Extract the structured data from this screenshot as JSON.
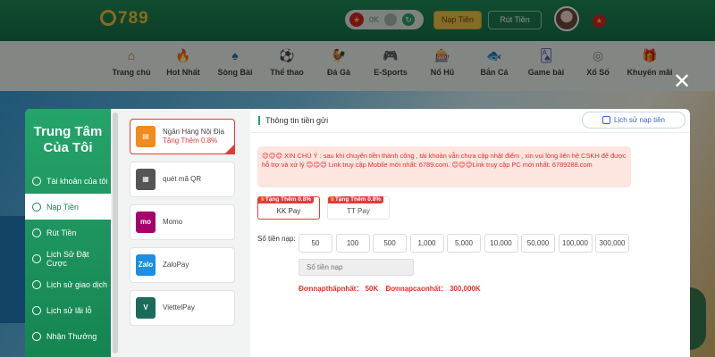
{
  "header": {
    "logo_text": "789",
    "balance": "0K",
    "deposit_label": "Nạp Tiền",
    "withdraw_label": "Rút Tiền",
    "flag_symbol": "★"
  },
  "nav": {
    "items": [
      {
        "label": "Trang chủ",
        "icon": "home-icon",
        "glyph": "⌂"
      },
      {
        "label": "Hot Nhất",
        "icon": "fire-icon",
        "glyph": "🔥"
      },
      {
        "label": "Sòng Bài",
        "icon": "dealer-icon",
        "glyph": "♠"
      },
      {
        "label": "Thể thao",
        "icon": "sports-icon",
        "glyph": "⚽"
      },
      {
        "label": "Đá Gà",
        "icon": "rooster-icon",
        "glyph": "🐓"
      },
      {
        "label": "E-Sports",
        "icon": "gamepad-icon",
        "glyph": "🎮"
      },
      {
        "label": "Nổ Hũ",
        "icon": "slot-icon",
        "glyph": "🎰"
      },
      {
        "label": "Bắn Cá",
        "icon": "fish-icon",
        "glyph": "🐟"
      },
      {
        "label": "Game bài",
        "icon": "cards-icon",
        "glyph": "🂡"
      },
      {
        "label": "Xổ Số",
        "icon": "lottery-icon",
        "glyph": "◎"
      },
      {
        "label": "Khuyến mãi",
        "icon": "gift-icon",
        "glyph": "🎁"
      }
    ]
  },
  "close_symbol": "✕",
  "sidebar": {
    "title": "Trung Tâm Của Tôi",
    "items": [
      {
        "label": "Tài khoản của tôi"
      },
      {
        "label": "Nạp Tiền"
      },
      {
        "label": "Rút Tiền"
      },
      {
        "label": "Lịch Sử Đặt Cược"
      },
      {
        "label": "Lịch sử giao dịch"
      },
      {
        "label": "Lịch sử lãi lỗ"
      },
      {
        "label": "Nhận Thưởng"
      }
    ]
  },
  "methods": [
    {
      "label": "Ngân Hàng Nội Địa",
      "sub": "Tặng Thêm 0.8%",
      "logo": "▤",
      "color": "#f28a1d"
    },
    {
      "label": "quét mã QR",
      "sub": "",
      "logo": "▦",
      "color": "#555555"
    },
    {
      "label": "Momo",
      "sub": "",
      "logo": "mo",
      "color": "#a5006b"
    },
    {
      "label": "ZaloPay",
      "sub": "",
      "logo": "Zalo",
      "color": "#1a8fe3"
    },
    {
      "label": "ViettelPay",
      "sub": "",
      "logo": "V",
      "color": "#1a6b5a"
    }
  ],
  "panel": {
    "title": "Thông tin tiền gửi",
    "history_button": "Lịch sử nạp tiền",
    "notice": "😊😊😊 XIN CHÚ Ý : sau khi chuyển tiền thành công , tài khoản vẫn chưa cập nhật điểm , xin vui lòng liên hệ CSKH để được hỗ trợ và xử lý 😊😊😊 Link truy cập Mobile mới nhất: 6789.com. 😊😊😊Link truy cập PC mới nhất: 6789288.com",
    "channels": [
      {
        "tag": "Tặng Thêm 0.8%",
        "name": "KK Pay"
      },
      {
        "tag": "Tặng Thêm 0.8%",
        "name": "TT Pay"
      }
    ],
    "amount_label": "Số tiền nạp:",
    "amounts": [
      "50",
      "100",
      "500",
      "1,000",
      "5,000",
      "10,000",
      "50,000",
      "100,000",
      "300,000"
    ],
    "amount_placeholder": "Số tiền nạp",
    "min_text": "Đơnnạpthấpnhất： 50K",
    "max_text": "Đơnnạpcaonhất： 300,000K"
  },
  "colors": {
    "brand_green": "#158451",
    "accent_red": "#e53a3a",
    "gold": "#f2c74a"
  }
}
